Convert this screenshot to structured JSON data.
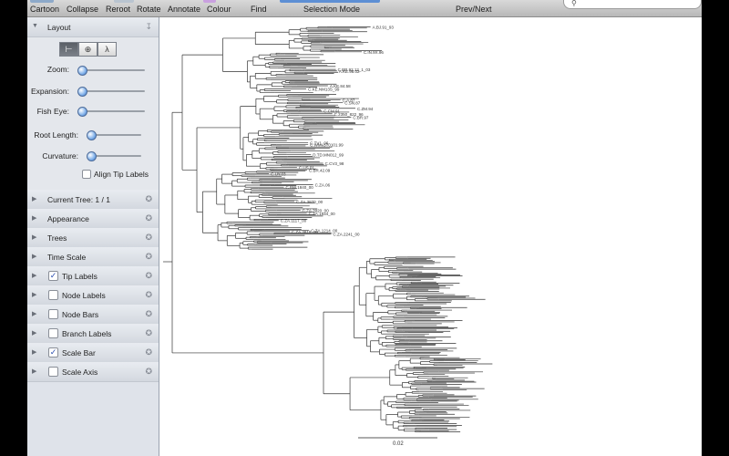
{
  "toolbar": {
    "items": [
      {
        "label": "Cartoon",
        "name": "cartoon-button"
      },
      {
        "label": "Collapse",
        "name": "collapse-button"
      },
      {
        "label": "Reroot",
        "name": "reroot-button"
      },
      {
        "label": "Rotate",
        "name": "rotate-button"
      },
      {
        "label": "Annotate",
        "name": "annotate-button"
      },
      {
        "label": "Colour",
        "name": "colour-button"
      },
      {
        "label": "Find",
        "name": "find-button"
      },
      {
        "label": "Selection Mode",
        "name": "selection-mode-control"
      },
      {
        "label": "Prev/Next",
        "name": "prev-next-control"
      }
    ]
  },
  "sidebar": {
    "layout": {
      "title": "Layout",
      "sliders": [
        {
          "label": "Zoom:",
          "value": 0
        },
        {
          "label": "Expansion:",
          "value": 0
        },
        {
          "label": "Fish Eye:",
          "value": 0
        },
        {
          "label": "Root Length:",
          "value": 0
        },
        {
          "label": "Curvature:",
          "value": 0
        }
      ],
      "align_tip_labels": {
        "label": "Align Tip Labels",
        "checked": false
      }
    },
    "panels": [
      {
        "label": "Current Tree: 1 / 1",
        "checkbox": false
      },
      {
        "label": "Appearance",
        "checkbox": false
      },
      {
        "label": "Trees",
        "checkbox": false
      },
      {
        "label": "Time Scale",
        "checkbox": false
      },
      {
        "label": "Tip Labels",
        "checkbox": true,
        "checked": true
      },
      {
        "label": "Node Labels",
        "checkbox": true,
        "checked": false
      },
      {
        "label": "Node Bars",
        "checkbox": true,
        "checked": false
      },
      {
        "label": "Branch Labels",
        "checkbox": true,
        "checked": false
      },
      {
        "label": "Scale Bar",
        "checkbox": true,
        "checked": true
      },
      {
        "label": "Scale Axis",
        "checkbox": true,
        "checked": false
      }
    ]
  },
  "tree": {
    "tip_labels": [
      "A.BJ.91_93",
      "C.IN.9X.96",
      "C.BR.92.12_1_03",
      "A.KE.98.02",
      "A.KE.84.58",
      "C.KE.NM13S_99",
      "C.A.87",
      "C.SN.87",
      "C.ZM.94",
      "C.CM.91",
      "C.2350_822_96",
      "C.BR.97",
      "C.TV1_06",
      "C.WMI.5T0101.99",
      "D.TD.MN012_99",
      "C.CV3_98",
      "C.US.01",
      "C.BR.42.09",
      "C.UY.03",
      "C.ZA.06",
      "C.BW.1840_00",
      "C.ZA.3870_00",
      "C.ZA.3920_00",
      "C.ZA.1534_00",
      "C.ZA.1117_00",
      "C.ZA.1214_00",
      "C.ZA.3819_00",
      "C.ZA.2241_00"
    ],
    "scale_bar_label": "0.02"
  },
  "colors": {
    "accent": "#3b6fbf",
    "sidebar_bg": "#dfe3ea",
    "tree_line": "#333333"
  }
}
